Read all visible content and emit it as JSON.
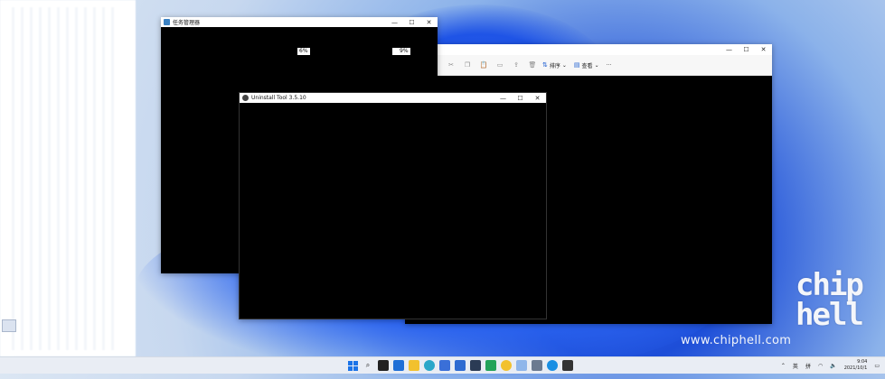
{
  "desktop": {
    "watermark": "www.chiphell.com",
    "logo_line1": "chip",
    "logo_line2": "hell"
  },
  "win_task_manager": {
    "title": "任务管理器",
    "cpu_percent": "6%",
    "mem_percent": "9%",
    "caps": {
      "min": "—",
      "max": "☐",
      "close": "✕"
    }
  },
  "win_explorer": {
    "toolbar_sort": "排序",
    "toolbar_view": "查看",
    "toolbar_more": "···",
    "caps": {
      "min": "—",
      "max": "☐",
      "close": "✕"
    }
  },
  "win_uninstall": {
    "title": "Uninstall Tool 3.5.10",
    "caps": {
      "min": "—",
      "max": "☐",
      "close": "✕"
    }
  },
  "taskbar": {
    "tray_lang": "英",
    "tray_ime": "拼",
    "time": "9:04",
    "date": "2021/10/1"
  }
}
